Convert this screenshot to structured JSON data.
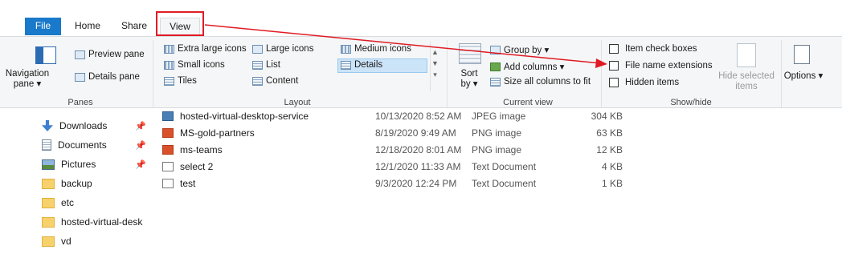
{
  "tabs": {
    "file": "File",
    "home": "Home",
    "share": "Share",
    "view": "View"
  },
  "panes": {
    "navigation_pane": "Navigation pane ▾",
    "preview_pane": "Preview pane",
    "details_pane": "Details pane",
    "group_label": "Panes"
  },
  "layout": {
    "items": [
      "Extra large icons",
      "Large icons",
      "Medium icons",
      "Small icons",
      "List",
      "Details",
      "Tiles",
      "Content"
    ],
    "group_label": "Layout"
  },
  "current_view": {
    "sort_by": "Sort by ▾",
    "group_by": "Group by ▾",
    "add_columns": "Add columns ▾",
    "size_all_columns": "Size all columns to fit",
    "group_label": "Current view"
  },
  "show_hide": {
    "item_check_boxes": "Item check boxes",
    "file_name_extensions": "File name extensions",
    "hidden_items": "Hidden items",
    "hide_selected_items": "Hide selected items",
    "group_label": "Show/hide"
  },
  "options": {
    "label": "Options ▾"
  },
  "sidebar": {
    "items": [
      "Downloads",
      "Documents",
      "Pictures",
      "backup",
      "etc",
      "hosted-virtual-desk",
      "vd"
    ]
  },
  "files": [
    {
      "name": "hosted-virtual-desktop-service",
      "date": "10/13/2020 8:52 AM",
      "type": "JPEG image",
      "size": "304 KB"
    },
    {
      "name": "MS-gold-partners",
      "date": "8/19/2020 9:49 AM",
      "type": "PNG image",
      "size": "63 KB"
    },
    {
      "name": "ms-teams",
      "date": "12/18/2020 8:01 AM",
      "type": "PNG image",
      "size": "12 KB"
    },
    {
      "name": "select 2",
      "date": "12/1/2020 11:33 AM",
      "type": "Text Document",
      "size": "4 KB"
    },
    {
      "name": "test",
      "date": "9/3/2020 12:24 PM",
      "type": "Text Document",
      "size": "1 KB"
    }
  ],
  "colors": {
    "file_tab": "#1979ca",
    "highlight": "#e01b24",
    "ribbon_bg": "#f5f6f7"
  }
}
